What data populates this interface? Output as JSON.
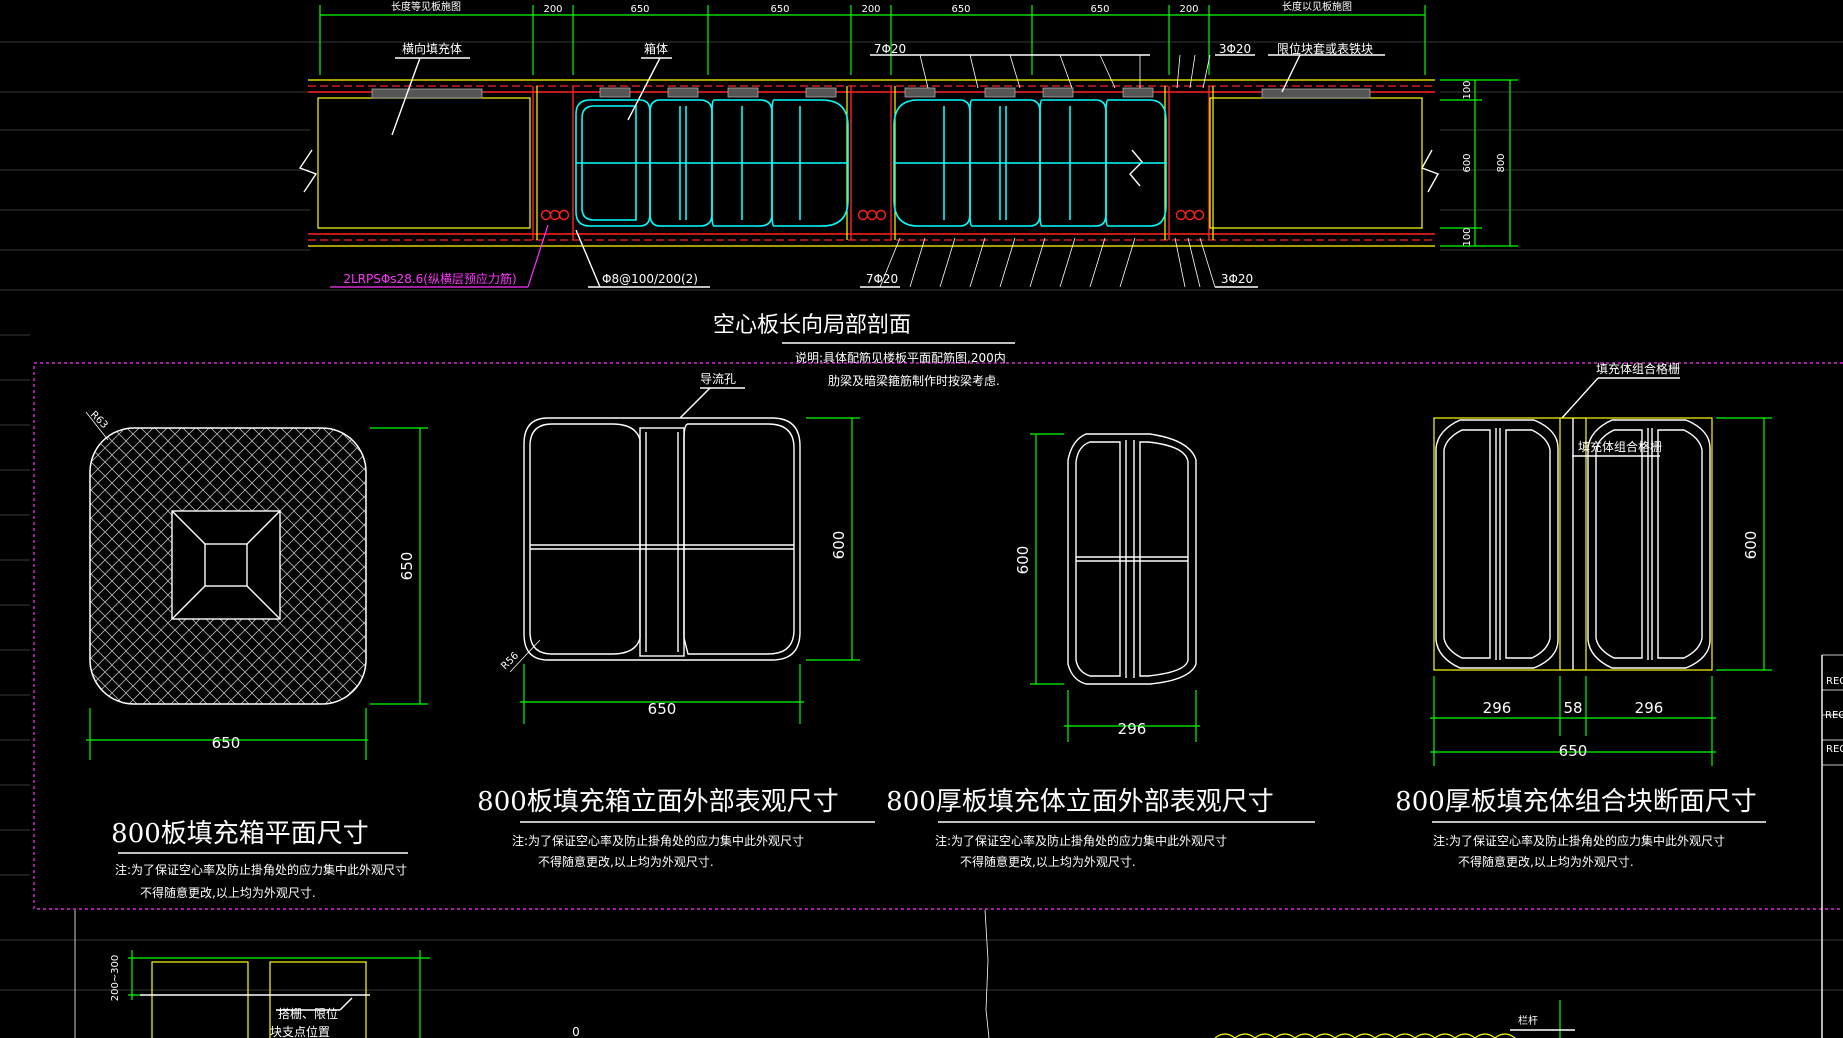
{
  "top_section": {
    "dims_top": [
      "200",
      "650",
      "650",
      "200",
      "650",
      "650",
      "200"
    ],
    "dim_side_left_label": "长度等见板施图",
    "dim_side_right_label": "长度以见板施图",
    "leader_filler": "横向填充体",
    "leader_box": "箱体",
    "leader_7phi20_top": "7Φ20",
    "leader_3phi20_top": "3Φ20",
    "leader_limit": "限位块套或表铁块",
    "leader_pt": "2LRPSΦs28.6(纵横层预应力筋)",
    "leader_stirrup": "Φ8@100/200(2)",
    "leader_7phi20_bottom": "7Φ20",
    "leader_3phi20_bottom": "3Φ20",
    "right_dims": [
      "100",
      "600",
      "100"
    ],
    "right_total": "800",
    "title": "空心板长向局部剖面",
    "note_line1": "说明:具体配筋见楼板平面配筋图,200内",
    "note_line2": "肋梁及暗梁箍筋制作时按梁考虑."
  },
  "panel1": {
    "corner_label": "R63",
    "dim_height": "650",
    "dim_width": "650",
    "title": "800板填充箱平面尺寸",
    "note_line1": "注:为了保证空心率及防止掛角处的应力集中此外观尺寸",
    "note_line2": "不得随意更改,以上均为外观尺寸."
  },
  "panel2": {
    "leader": "导流孔",
    "corner_label": "R56",
    "dim_height": "600",
    "dim_width": "650",
    "title": "800板填充箱立面外部表观尺寸",
    "note_line1": "注:为了保证空心率及防止掛角处的应力集中此外观尺寸",
    "note_line2": "不得随意更改,以上均为外观尺寸."
  },
  "panel3": {
    "dim_height": "600",
    "dim_width": "296",
    "title": "800厚板填充体立面外部表观尺寸",
    "note_line1": "注:为了保证空心率及防止掛角处的应力集中此外观尺寸",
    "note_line2": "不得随意更改,以上均为外观尺寸."
  },
  "panel4": {
    "leader_top": "填充体组合格栅",
    "leader_mid": "填充体组合格栅",
    "dim_height": "600",
    "dim_parts": [
      "296",
      "58",
      "296"
    ],
    "dim_total": "650",
    "title": "800厚板填充体组合块断面尺寸",
    "note_line1": "注:为了保证空心率及防止掛角处的应力集中此外观尺寸",
    "note_line2": "不得随意更改,以上均为外观尺寸."
  },
  "bottom": {
    "dim_vertical": "200~300",
    "leader": "搭栅、限位",
    "leader_line2": "块支点位置",
    "small_label": "0",
    "right_label": "栏杆"
  },
  "sidebar_labels": [
    "REGI",
    "REGIS",
    "REGI"
  ],
  "colors": {
    "dimension": "#00ff00",
    "outline": "#ffffff",
    "box": "#00ffff",
    "rebar": "#ff2222",
    "annotation": "#ff33ff",
    "frame": "#ffff00"
  }
}
